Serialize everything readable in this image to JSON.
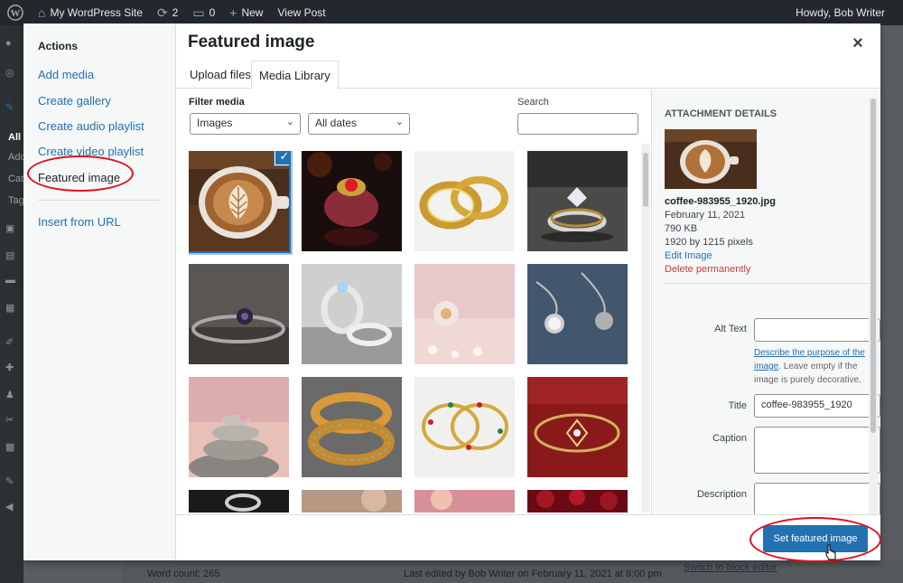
{
  "admin_bar": {
    "site_name": "My WordPress Site",
    "updates_count": "2",
    "comments_count": "0",
    "new_label": "New",
    "view_post_label": "View Post",
    "greeting": "Howdy, Bob Writer"
  },
  "admin_sidebar": {
    "items": [
      "All",
      "Add",
      "Cat",
      "Tag"
    ]
  },
  "modal": {
    "title": "Featured image",
    "close_icon": "close-icon",
    "menu": {
      "heading": "Actions",
      "items": [
        {
          "label": "Add media"
        },
        {
          "label": "Create gallery"
        },
        {
          "label": "Create audio playlist"
        },
        {
          "label": "Create video playlist"
        },
        {
          "label": "Featured image"
        },
        {
          "label": "Insert from URL"
        }
      ]
    },
    "tabs": [
      {
        "label": "Upload files"
      },
      {
        "label": "Media Library"
      }
    ],
    "filter": {
      "label": "Filter media",
      "type_value": "Images",
      "date_value": "All dates"
    },
    "search": {
      "label": "Search",
      "value": ""
    },
    "grid_images": [
      "coffee-latte",
      "ring-red-gem",
      "gold-bands",
      "diamond-ring",
      "ring-dark-stone",
      "ring-pair-silver",
      "ring-pink-background",
      "pocket-watch-necklace",
      "heart-pendant-stones",
      "gold-bangles",
      "beaded-bangles",
      "gold-bracelet-red",
      "ring-dark",
      "blurred-tan",
      "blurred-pink",
      "red-roses"
    ],
    "attachment": {
      "heading": "Attachment Details",
      "filename": "coffee-983955_1920.jpg",
      "date": "February 11, 2021",
      "size": "790 KB",
      "dimensions": "1920 by 1215 pixels",
      "edit_label": "Edit Image",
      "delete_label": "Delete permanently",
      "fields": {
        "alt_label": "Alt Text",
        "alt_value": "",
        "alt_help_link": "Describe the purpose of the image",
        "alt_help_text": ". Leave empty if the image is purely decorative.",
        "title_label": "Title",
        "title_value": "coffee-983955_1920",
        "caption_label": "Caption",
        "caption_value": "",
        "description_label": "Description",
        "description_value": ""
      }
    },
    "primary_button": "Set featured image"
  },
  "editor_status": {
    "word_count": "Word count: 265",
    "last_edited": "Last edited by Bob Writer on February 11, 2021 at 8:00 pm",
    "switch_link": "Switch to block editor"
  },
  "colors": {
    "accent": "#2271b1",
    "highlight": "#e00d1b",
    "delete": "#d63638"
  }
}
